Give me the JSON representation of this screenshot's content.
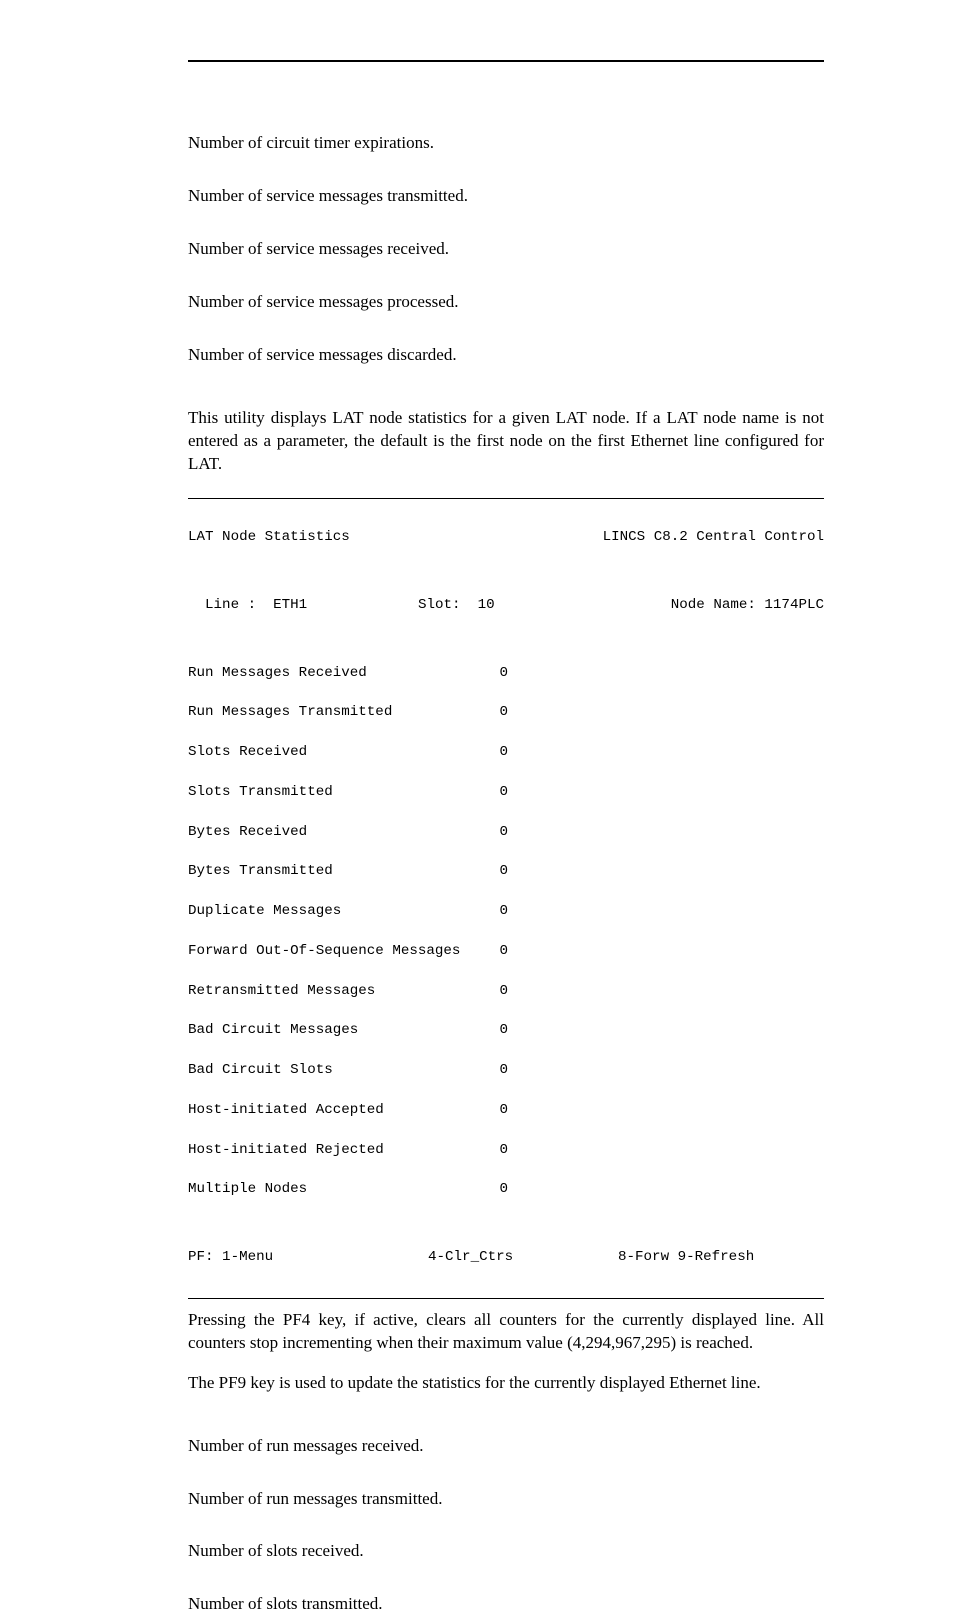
{
  "definitions_top": [
    "Number of circuit timer expirations.",
    "Number of service messages transmitted.",
    "Number of service messages received.",
    "Number of service messages processed.",
    "Number of service messages discarded."
  ],
  "intro": "This utility displays LAT node statistics for a given LAT node. If a LAT node name is not entered as a parameter, the default is the first node on the first Ethernet line configured for LAT.",
  "terminal": {
    "title_left": "LAT Node Statistics",
    "title_right": "LINCS C8.2 Central Control",
    "line_label": "  Line :  ETH1",
    "slot_label": "Slot:  10",
    "node_label": "Node Name: 1174PLC",
    "rows": [
      {
        "label": "Run Messages Received",
        "value": "0"
      },
      {
        "label": "Run Messages Transmitted",
        "value": "0"
      },
      {
        "label": "Slots Received",
        "value": "0"
      },
      {
        "label": "Slots Transmitted",
        "value": "0"
      },
      {
        "label": "Bytes Received",
        "value": "0"
      },
      {
        "label": "Bytes Transmitted",
        "value": "0"
      },
      {
        "label": "Duplicate Messages",
        "value": "0"
      },
      {
        "label": "Forward Out-Of-Sequence Messages",
        "value": "0"
      },
      {
        "label": "Retransmitted Messages",
        "value": "0"
      },
      {
        "label": "Bad Circuit Messages",
        "value": "0"
      },
      {
        "label": "Bad Circuit Slots",
        "value": "0"
      },
      {
        "label": "Host-initiated Accepted",
        "value": "0"
      },
      {
        "label": "Host-initiated Rejected",
        "value": "0"
      },
      {
        "label": "Multiple Nodes",
        "value": "0"
      }
    ],
    "pf_a": "PF: 1-Menu",
    "pf_b": "4-Clr_Ctrs",
    "pf_c": "8-Forw 9-Refresh"
  },
  "after_terminal_1": "Pressing the PF4 key, if active, clears all counters for the currently displayed line. All counters stop incrementing when their maximum value (4,294,967,295) is reached.",
  "after_terminal_2": "The PF9 key is used to update the statistics for the currently displayed Ethernet line.",
  "definitions_bottom": [
    "Number of run messages received.",
    "Number of run messages transmitted.",
    "Number of slots received.",
    "Number of slots transmitted."
  ]
}
